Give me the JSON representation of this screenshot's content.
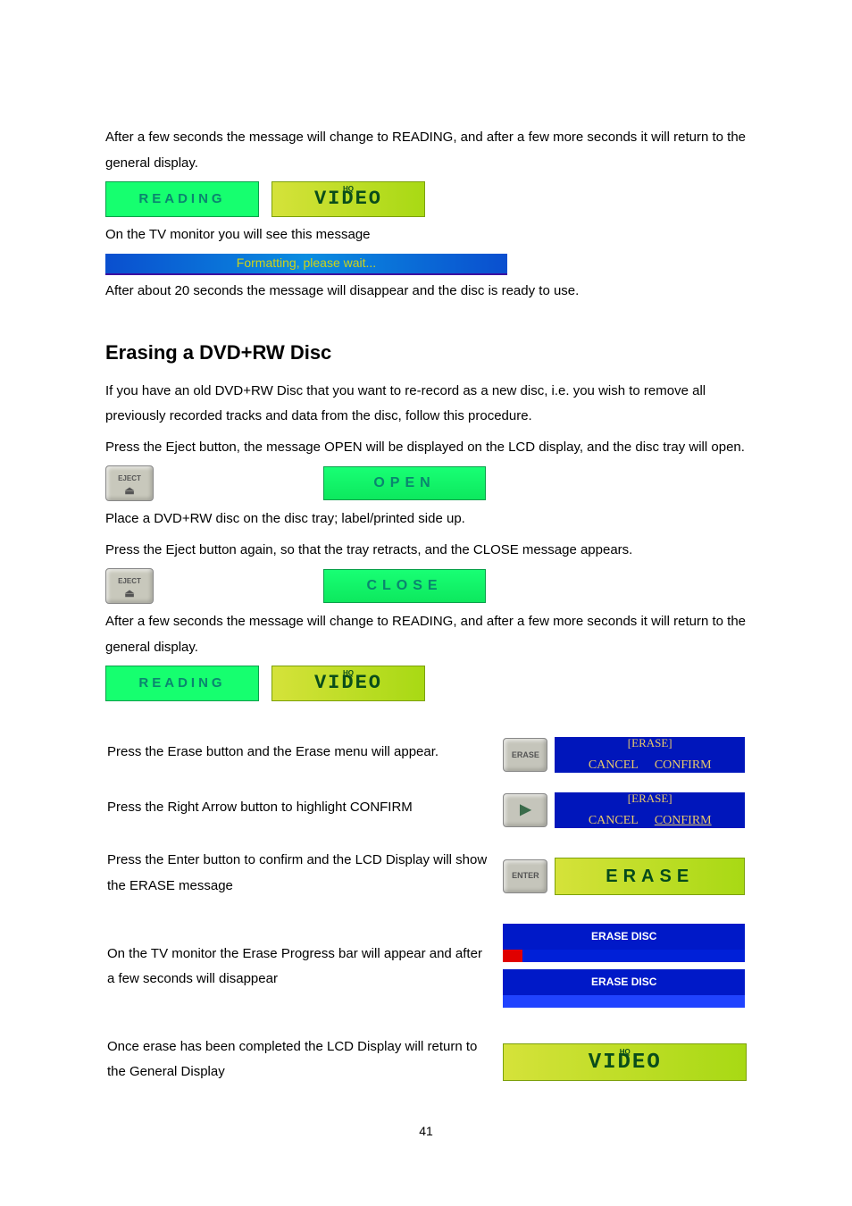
{
  "p1": "After a few seconds the message will change to READING, and after a few more seconds it will return to the general display.",
  "lcd_reading": "READING",
  "lcd_hq": "HQ",
  "lcd_video": "VIDEO",
  "p2": "On the TV monitor you will see this message",
  "tv_formatting": "Formatting, please wait...",
  "p3": "After about 20 seconds the message will disappear and the disc is ready to use.",
  "h_erase": "Erasing a DVD+RW Disc",
  "p4": "If you have an old DVD+RW Disc that you want to re-record as a new disc, i.e. you wish to remove all previously recorded tracks and data from the disc, follow this procedure.",
  "p5": "Press the Eject button, the message OPEN will be displayed on the LCD display, and the disc tray will open.",
  "btn_eject": "EJECT",
  "lcd_open": "OPEN",
  "p6": "Place a DVD+RW disc on the disc tray; label/printed side up.",
  "p7": "Press the Eject button again, so that the tray retracts, and the CLOSE message appears.",
  "lcd_close": "CLOSE",
  "p8": "After a few seconds the message will change to READING, and after a few more seconds it will return to the general display.",
  "steps": {
    "s1": "Press the Erase button and the Erase menu will appear.",
    "s2": "Press the Right Arrow button to highlight CONFIRM",
    "s3": "Press the Enter button to confirm and the LCD Display will show the ERASE message",
    "s4": "On the TV monitor the Erase Progress bar will appear and after a few seconds will disappear",
    "s5": "Once erase has been completed the LCD Display will return to the General Display"
  },
  "btn_erase": "ERASE",
  "btn_enter": "ENTER",
  "menu": {
    "title": "[ERASE]",
    "cancel": "CANCEL",
    "confirm": "CONFIRM"
  },
  "lcd_erase": "ERASE",
  "prog_label": "ERASE DISC",
  "pagenum": "41"
}
